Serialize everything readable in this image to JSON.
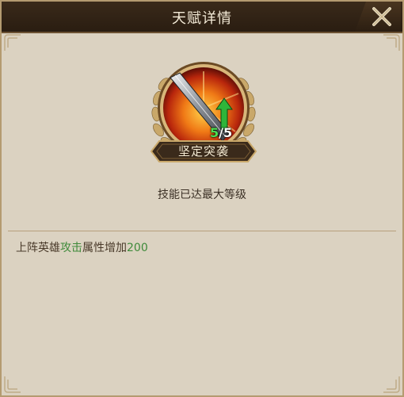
{
  "header": {
    "title": "天赋详情",
    "close_icon": "close-x-icon"
  },
  "skill": {
    "icon": "sword-upgrade-icon",
    "level_current": "5",
    "level_separator": "/",
    "level_max": "5",
    "name": "坚定突袭"
  },
  "status_text": "技能已达最大等级",
  "description": {
    "prefix": "上阵英雄",
    "attribute": "攻击",
    "middle": "属性增加",
    "value": "200"
  },
  "colors": {
    "header_bg": "#2f2216",
    "panel_bg": "#dbd2c1",
    "highlight_green": "#3f8a3a",
    "level_green": "#4ce052",
    "gold_frame": "#c9a86a"
  }
}
